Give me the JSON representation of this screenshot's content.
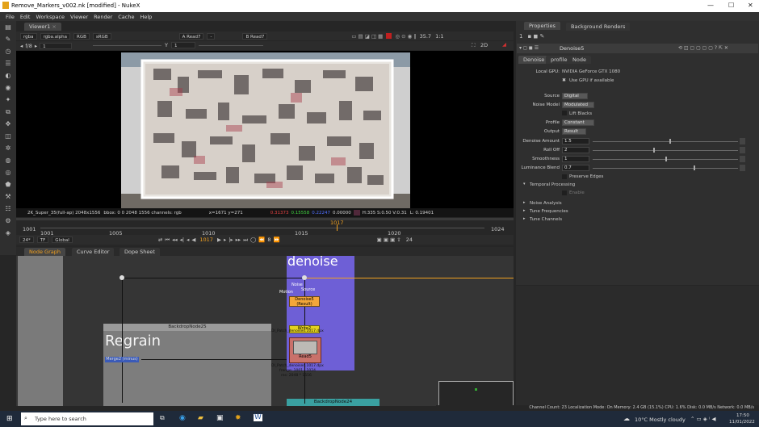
{
  "window": {
    "title": "Remove_Markers_v002.nk [modified] - NukeX"
  },
  "menu": [
    "File",
    "Edit",
    "Workspace",
    "Viewer",
    "Render",
    "Cache",
    "Help"
  ],
  "viewer": {
    "tab": "Viewer1",
    "controls": {
      "layer": "rgba",
      "channel": "rgba.alpha",
      "color": "RGB",
      "lut": "sRGB",
      "a_input": "Read7",
      "a_op": "-",
      "b_input": "Read7",
      "zoom": "35.7",
      "scale": "1:1",
      "view": "2D",
      "fstop": "f/8",
      "gain": "1",
      "gamma": "1",
      "y_label": "Y"
    },
    "status": {
      "format": "2K_Super_35(full-ap) 2048x1556",
      "bbox": "bbox: 0 0 2048 1556 channels: rgb",
      "coords": "x=1671 y=271",
      "r": "0.31373",
      "g": "0.15558",
      "b": "0.22247",
      "a": "0.00000",
      "hsv": "H:335 S:0.50 V:0.31",
      "l": "L: 0.19401"
    }
  },
  "timeline": {
    "start": "1001",
    "end": "1024",
    "ticks": [
      "1001",
      "1005",
      "1010",
      "1015",
      "1020"
    ],
    "current": "1017",
    "fps": "24*",
    "tf": "TF",
    "global": "Global",
    "frame": "1017",
    "step": "8",
    "end_field": "24"
  },
  "panels": {
    "tabs": [
      "Node Graph",
      "Curve Editor",
      "Dope Sheet"
    ]
  },
  "nodegraph": {
    "backdrops": [
      {
        "name": "denoise",
        "label": "denoise"
      },
      {
        "name": "regrain",
        "label": "Regrain",
        "header": "BackdropNode25"
      },
      {
        "name": "backdrop24",
        "label": "BackdropNode24"
      }
    ],
    "nodes": {
      "denoise_inputs": {
        "noise": "Noise",
        "source": "Source",
        "motion": "Motion"
      },
      "denoise5": {
        "name": "Denoise5",
        "sub": "(Result)"
      },
      "write2": {
        "name": "Write2",
        "file": "DI_Patch_denoised.1017.dpx"
      },
      "read5": {
        "name": "Read5",
        "file": "DI_Patch_denoised.1017.dpx",
        "range": "frange: 1001 - 1024",
        "res": "res: 2048 * 1556"
      },
      "merge": {
        "name": "Merge2 (minus)"
      }
    }
  },
  "properties": {
    "tabs": [
      "Properties",
      "Background Renders"
    ],
    "node_name": "Denoise5",
    "subtabs": [
      "Denoise",
      "profile",
      "Node"
    ],
    "local_gpu_label": "Local GPU:",
    "local_gpu": "NVIDIA GeForce GTX 1080",
    "use_gpu": "Use GPU if available",
    "source_label": "Source",
    "source": "Digital",
    "noise_model_label": "Noise Model",
    "noise_model": "Modulated",
    "lift_blacks": "Lift Blacks",
    "profile_label": "Profile",
    "profile": "Constant",
    "output_label": "Output",
    "output": "Result",
    "denoise_amount_label": "Denoise Amount",
    "denoise_amount": "1.5",
    "roll_off_label": "Roll Off",
    "roll_off": "2",
    "smoothness_label": "Smoothness",
    "smoothness": "1",
    "luminance_blend_label": "Luminance Blend",
    "luminance_blend": "0.7",
    "preserve_edges": "Preserve Edges",
    "temporal": "Temporal Processing",
    "enable": "Enable",
    "noise_analysis": "Noise Analysis",
    "tune_freq": "Tune Frequencies",
    "tune_channels": "Tune Channels"
  },
  "status_bar": "Channel Count: 23  Localization Mode: On  Memory: 2.4 GB (15.1%)  CPU: 1.6%  Disk: 0.0 MB/s  Network: 0.0 MB/s",
  "taskbar": {
    "search": "Type here to search",
    "weather": "10°C  Mostly cloudy",
    "time": "17:50",
    "date": "11/01/2022"
  }
}
